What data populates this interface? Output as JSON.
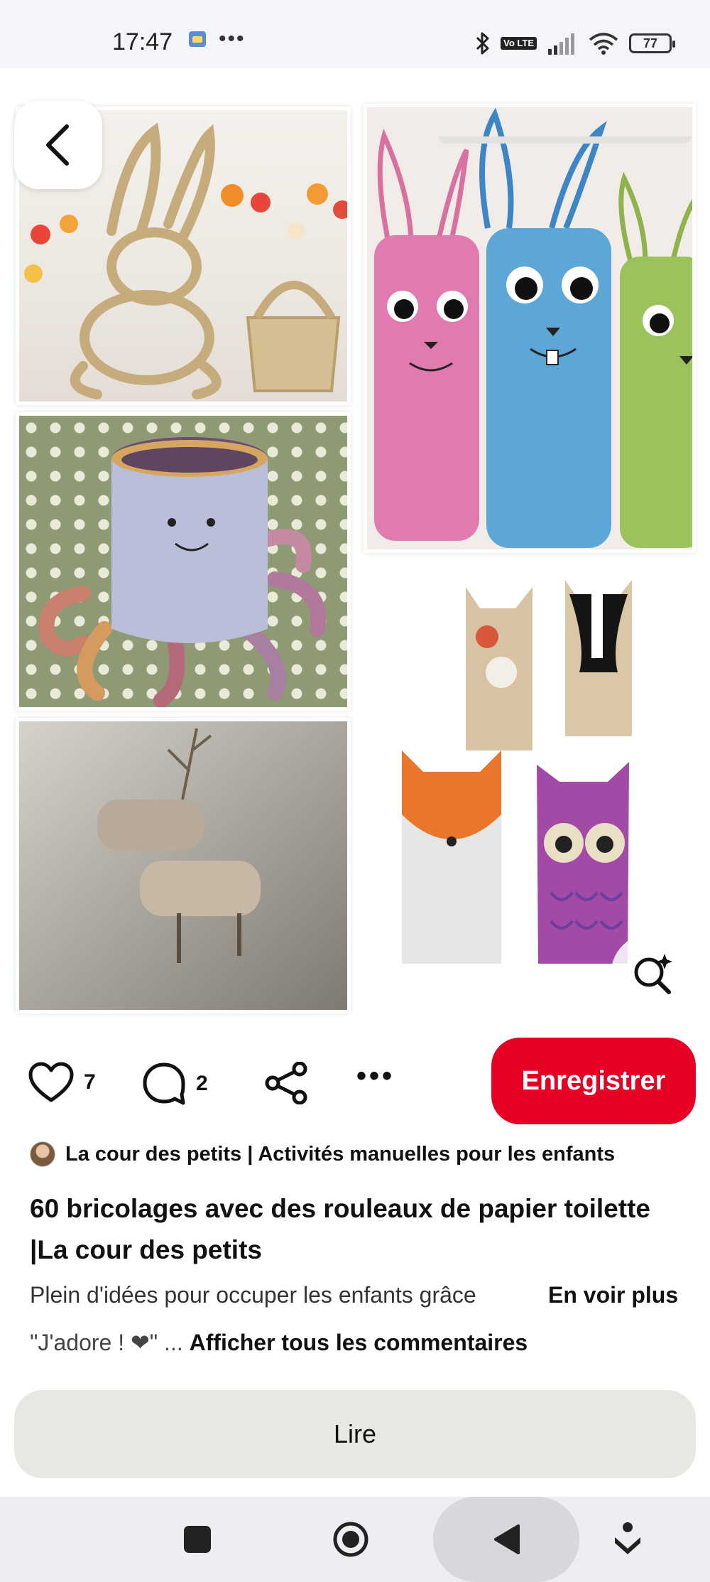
{
  "status_bar": {
    "time": "17:47",
    "dots": "•••",
    "volte": "Vo LTE",
    "battery": "77",
    "icons": [
      "app-notification-icon",
      "bluetooth-icon",
      "volte-icon",
      "signal-icon",
      "wifi-icon",
      "battery-icon"
    ]
  },
  "pin": {
    "images": [
      "paper-roll-bunny-and-basket",
      "paper-roll-rabbits",
      "paper-roll-octopus",
      "paper-roll-forest-animals",
      "paper-roll-reindeer"
    ]
  },
  "actions": {
    "like_count": "7",
    "comment_count": "2",
    "more": "•••",
    "save_label": "Enregistrer"
  },
  "creator": {
    "name": "La cour des petits | Activités manuelles pour les enfants"
  },
  "title": "60 bricolages avec des rouleaux de papier toilette |La cour des petits",
  "description": {
    "text": "Plein d'idées pour occuper les enfants grâce",
    "see_more": "En voir plus"
  },
  "comments": {
    "preview": "\"J'adore ! ❤\" ...",
    "show_all": "Afficher tous les commentaires"
  },
  "read_button": "Lire",
  "colors": {
    "accent": "#e60023",
    "read_button_bg": "#e8e8e3",
    "status_bar_bg": "#f4f5f8",
    "nav_bar_bg": "#eceef2"
  }
}
